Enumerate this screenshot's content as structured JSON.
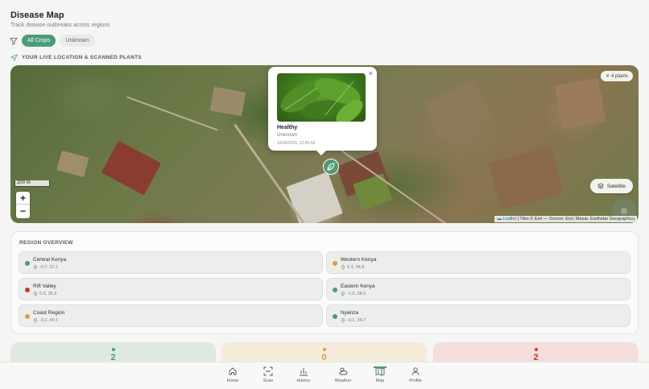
{
  "header": {
    "title": "Disease Map",
    "subtitle": "Track disease outbreaks across regions"
  },
  "filters": {
    "options": [
      "All Crops",
      "Unknown"
    ],
    "active": "All Crops"
  },
  "map_section": {
    "label": "YOUR LIVE LOCATION & SCANNED PLANTS"
  },
  "map": {
    "plants_badge": "4 plants",
    "scale_label": "200 m",
    "zoom_in": "+",
    "zoom_out": "−",
    "layer_button": "Satellite",
    "attribution_link": "Leaflet",
    "attribution_text": "| Tiles © Esri — Source: Esri, Maxar, Earthstar Geographics",
    "popup": {
      "close": "×",
      "status": "Healthy",
      "crop": "Unknown",
      "timestamp": "19/05/2025, 12:45:56"
    }
  },
  "regions": {
    "title": "REGION OVERVIEW",
    "items": [
      {
        "name": "Central Kenya",
        "coords": "-0.7, 37.1",
        "status_color": "#4a9c7a"
      },
      {
        "name": "Western Kenya",
        "coords": "0.3, 34.8",
        "status_color": "#e0a040"
      },
      {
        "name": "Rift Valley",
        "coords": "0.5, 35.9",
        "status_color": "#c83a2e"
      },
      {
        "name": "Eastern Kenya",
        "coords": "-1.0, 38.0",
        "status_color": "#4a9c7a"
      },
      {
        "name": "Coast Region",
        "coords": "-3.2, 40.1",
        "status_color": "#e0a040"
      },
      {
        "name": "Nyanza",
        "coords": "-0.1, 34.7",
        "status_color": "#4a9c7a"
      }
    ]
  },
  "stats": [
    {
      "value": "2",
      "color": "#4a9c7a",
      "bg": "#dde9e1"
    },
    {
      "value": "0",
      "color": "#e0a040",
      "bg": "#f4ebdb"
    },
    {
      "value": "2",
      "color": "#c83a2e",
      "bg": "#f4dedb"
    }
  ],
  "nav": {
    "items": [
      {
        "label": "Home",
        "icon": "home-icon"
      },
      {
        "label": "Scan",
        "icon": "scan-icon"
      },
      {
        "label": "History",
        "icon": "history-icon"
      },
      {
        "label": "Weather",
        "icon": "weather-icon"
      },
      {
        "label": "Map",
        "icon": "map-icon"
      },
      {
        "label": "Profile",
        "icon": "profile-icon"
      }
    ],
    "active": "Map"
  },
  "colors": {
    "accent": "#4a9c7a",
    "healthy": "#4a9c7a",
    "warning": "#e0a040",
    "danger": "#c83a2e"
  }
}
